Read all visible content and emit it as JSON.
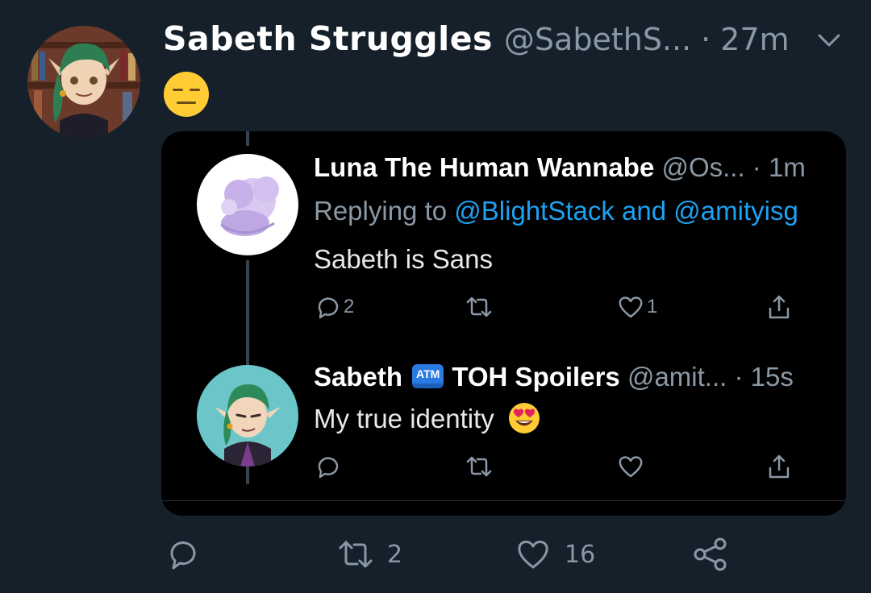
{
  "tweet": {
    "author_name": "Sabeth Struggles",
    "author_handle": "@SabethS...",
    "separator": "·",
    "time": "27m",
    "emoji": "expressionless-face",
    "reply_count": "",
    "retweet_count": "2",
    "like_count": "16"
  },
  "quoted": {
    "post1": {
      "name": "Luna The Human Wannabe",
      "handle_time": "@Os... · 1m",
      "replying_prefix": "Replying to ",
      "replying_user1": "@BlightStack",
      "replying_and": " and ",
      "replying_user2": "@amityisg",
      "text": "Sabeth is Sans",
      "reply_count": "2",
      "retweet_count": "",
      "like_count": "1"
    },
    "post2": {
      "name_part1": "Sabeth",
      "badge": "ATM",
      "name_part2": "TOH Spoilers",
      "handle_time": "@amit... · 15s",
      "text": "My true identity",
      "emoji": "heart-eyes-face"
    }
  },
  "colors": {
    "background": "#15202b",
    "card": "#000000",
    "muted": "#8899a6",
    "link": "#1da1f2"
  }
}
